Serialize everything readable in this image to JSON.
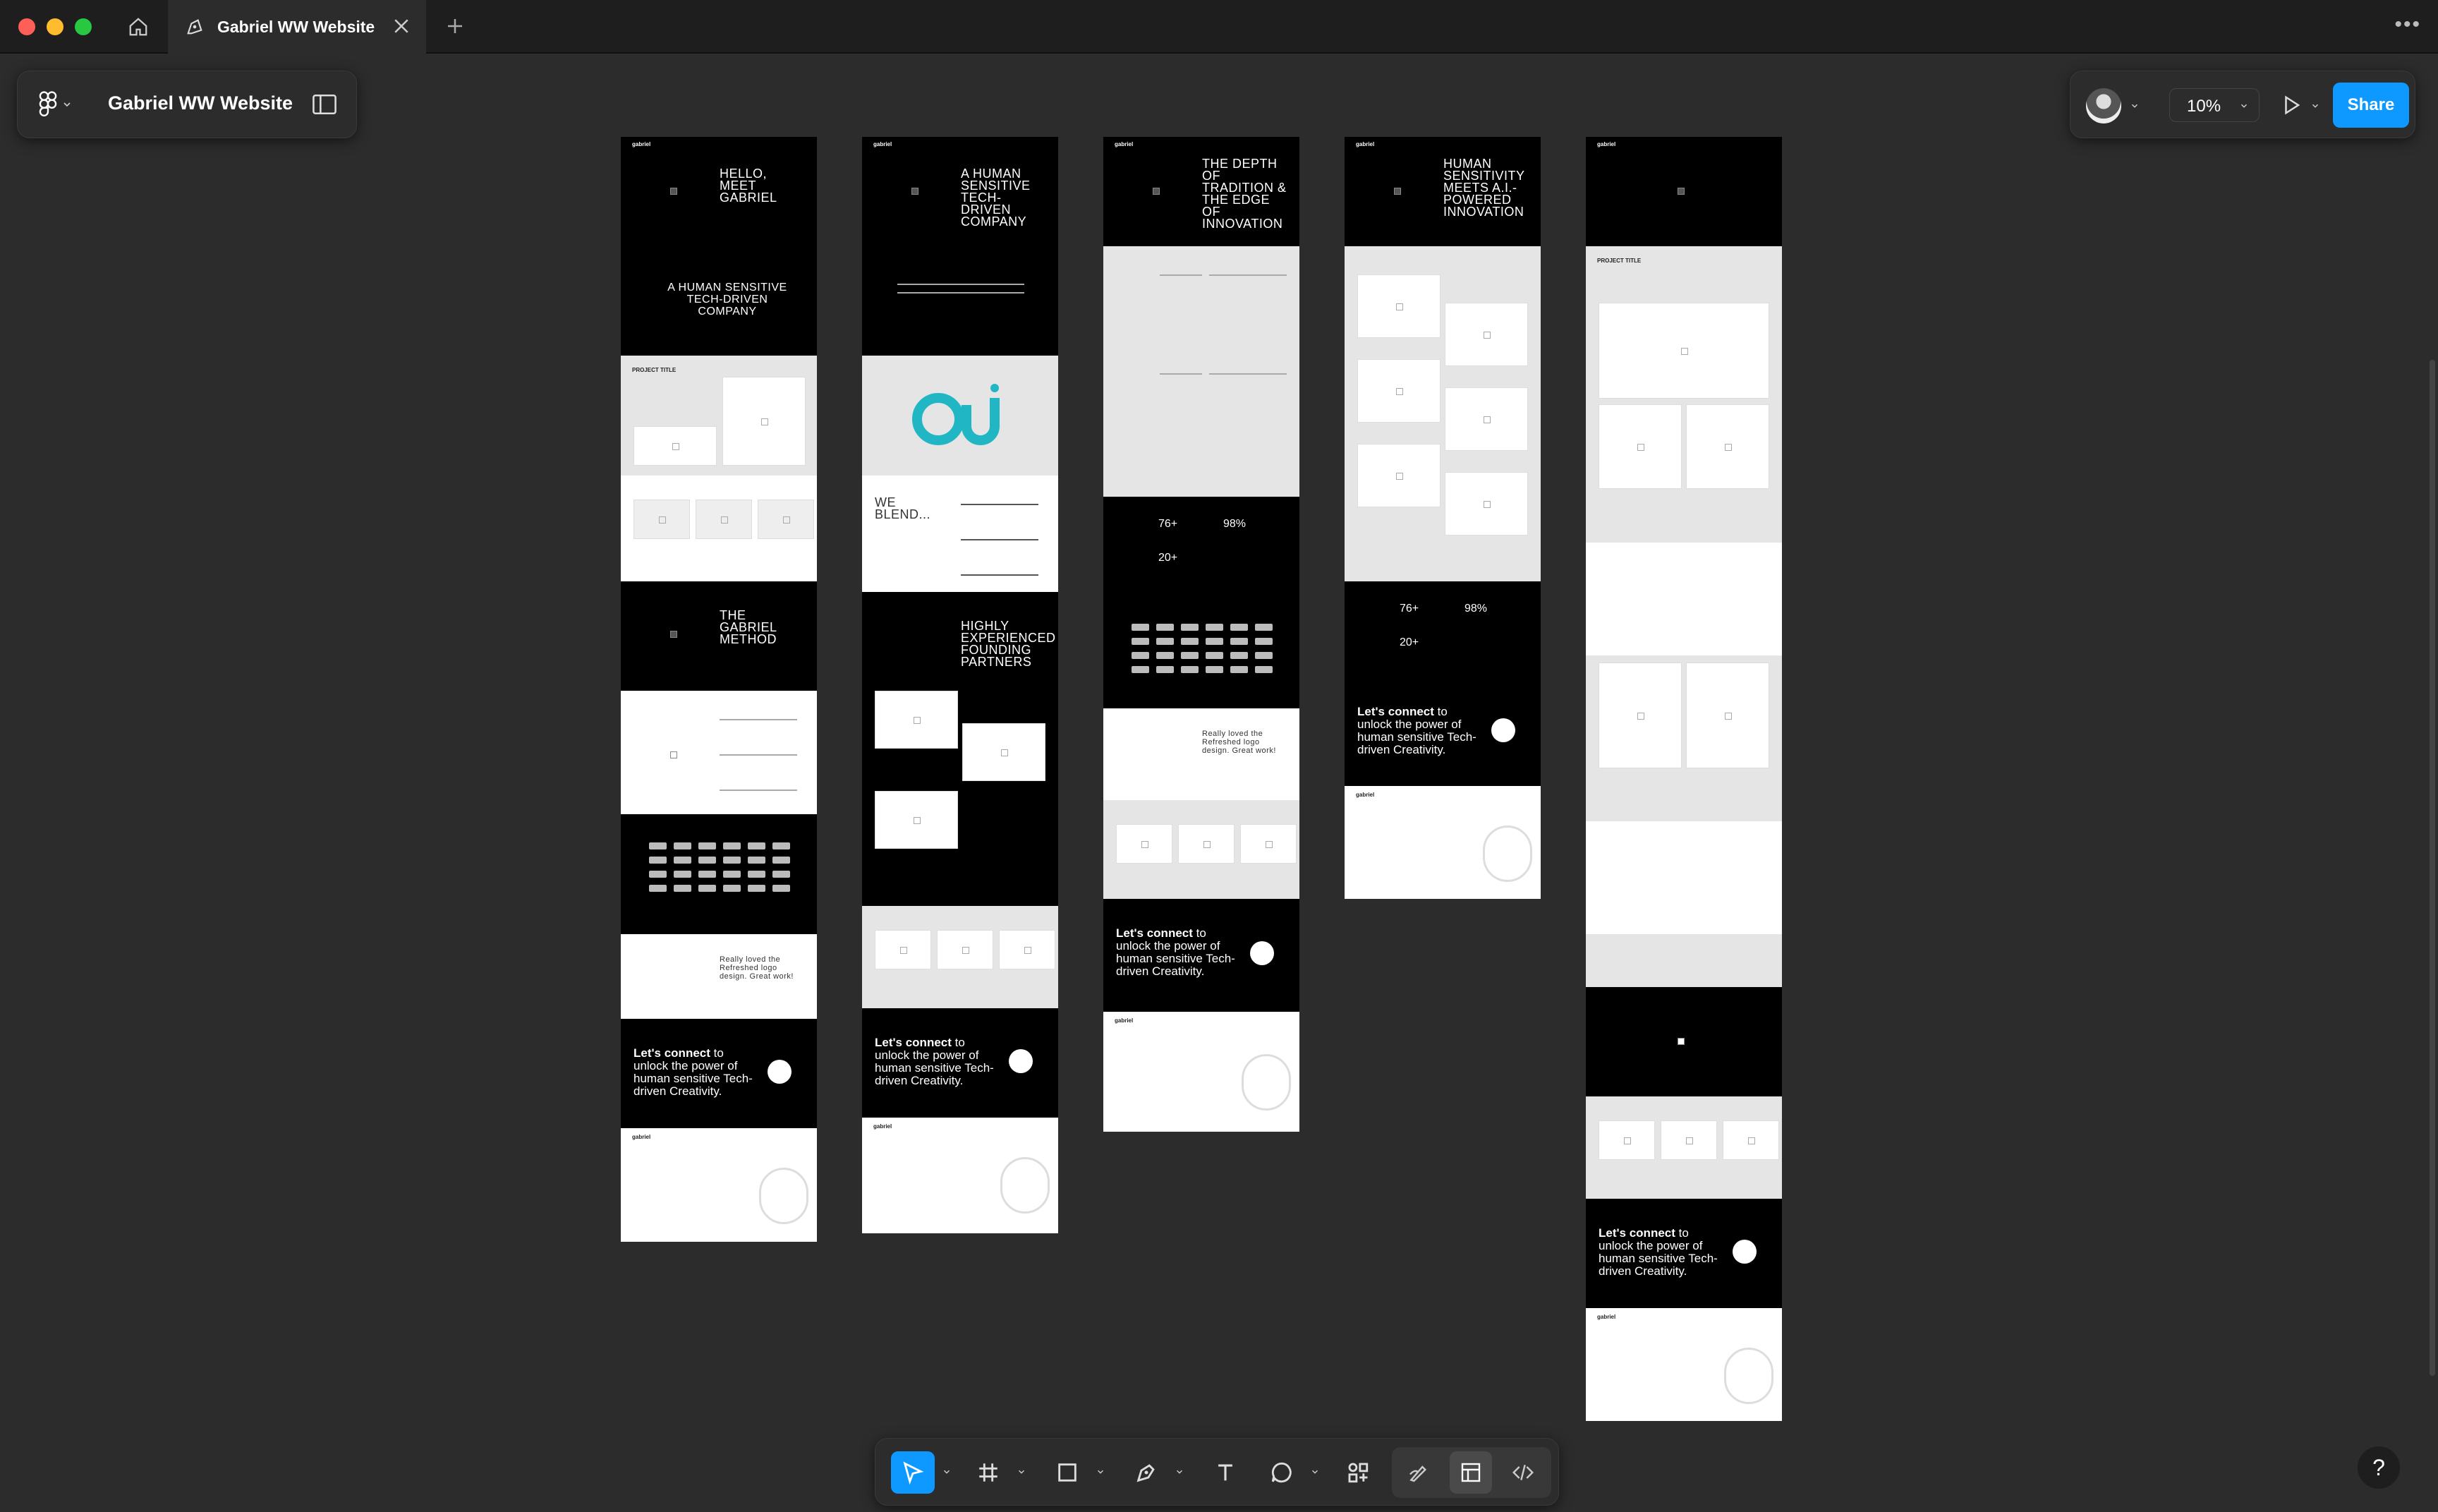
{
  "window": {
    "tab_title": "Gabriel WW Website",
    "traffic_colors": {
      "close": "#ff5f57",
      "minimize": "#febc2e",
      "zoom": "#28c840"
    }
  },
  "filebar": {
    "file_name": "Gabriel WW Website"
  },
  "rightbar": {
    "zoom_level": "10%",
    "share_label": "Share"
  },
  "frames": {
    "f1": {
      "hero": "HELLO, MEET GABRIEL",
      "tagline": "A HUMAN SENSITIVE TECH-DRIVEN COMPANY",
      "section_project": "PROJECT TITLE",
      "method": "THE GABRIEL METHOD",
      "cta_bold": "Let's connect",
      "cta_rest": " to unlock the power of human sensitive Tech-driven Creativity.",
      "quote": "Really loved the Refreshed logo design. Great work!",
      "brand": "gabriel"
    },
    "f2": {
      "hero": "A HUMAN SENSITIVE TECH-DRIVEN COMPANY",
      "blend": "WE BLEND...",
      "partners": "HIGHLY EXPERIENCED FOUNDING PARTNERS",
      "cta_bold": "Let's connect",
      "cta_rest": " to unlock the power of human sensitive Tech-driven Creativity.",
      "brand": "gabriel"
    },
    "f3": {
      "hero": "THE DEPTH OF TRADITION & THE EDGE OF INNOVATION",
      "stat_a": "76+",
      "stat_b": "98%",
      "stat_c": "20+",
      "quote": "Really loved the Refreshed logo design. Great work!",
      "cta_bold": "Let's connect",
      "cta_rest": " to unlock the power of human sensitive Tech-driven Creativity.",
      "brand": "gabriel"
    },
    "f4": {
      "hero": "HUMAN SENSITIVITY MEETS A.I.-POWERED INNOVATION",
      "stat_a": "76+",
      "stat_b": "98%",
      "stat_c": "20+",
      "cta_bold": "Let's connect",
      "cta_rest": " to unlock the power of human sensitive Tech-driven Creativity.",
      "brand": "gabriel"
    },
    "f5": {
      "section_project": "PROJECT TITLE",
      "cta_bold": "Let's connect",
      "cta_rest": " to unlock the power of human sensitive Tech-driven Creativity.",
      "brand": "gabriel"
    }
  },
  "toolbar": {
    "tools": [
      "move-tool",
      "frame-tool",
      "shape-tool",
      "pen-tool",
      "text-tool",
      "comment-tool",
      "actions-tool",
      "draw-mode",
      "design-mode",
      "dev-mode"
    ]
  },
  "help_label": "?"
}
